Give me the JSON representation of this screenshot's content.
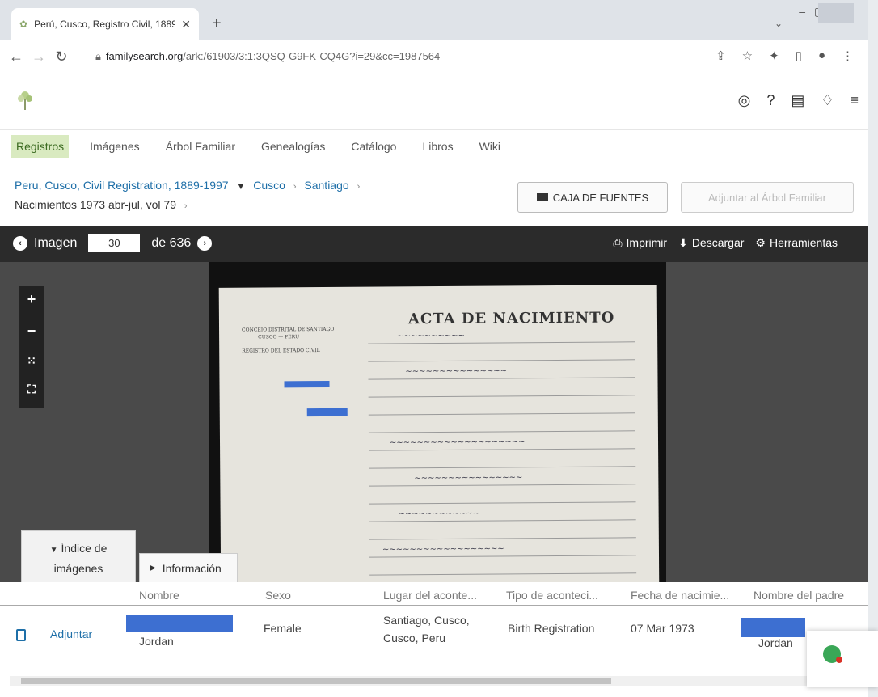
{
  "browser": {
    "tab_title": "Perú, Cusco, Registro Civil, 1889-",
    "url_host": "familysearch.org",
    "url_path": "/ark:/61903/3:1:3QSQ-G9FK-CQ4G?i=29&cc=1987564"
  },
  "nav": {
    "items": [
      "Registros",
      "Imágenes",
      "Árbol Familiar",
      "Genealogías",
      "Catálogo",
      "Libros",
      "Wiki"
    ],
    "active": "Registros"
  },
  "breadcrumb": {
    "collection": "Peru, Cusco, Civil Registration, 1889-1997",
    "level1": "Cusco",
    "level2": "Santiago",
    "volume": "Nacimientos 1973 abr-jul, vol 79"
  },
  "buttons": {
    "caja": "CAJA DE FUENTES",
    "adjuntar_arbol": "Adjuntar al Árbol Familiar"
  },
  "viewer": {
    "imagen_label": "Imagen",
    "page": "30",
    "of_label": "de 636",
    "print": "Imprimir",
    "download": "Descargar",
    "tools": "Herramientas",
    "doc_title": "ACTA DE NACIMIENTO",
    "doc_org": "CONCEJO DISTRITAL DE SANTIAGO",
    "doc_country": "CUSCO — PERU",
    "doc_office": "REGISTRO DEL ESTADO CIVIL"
  },
  "panels": {
    "indice_line1": "Índice de",
    "indice_line2": "imágenes",
    "informacion": "Información"
  },
  "table": {
    "headers": [
      "Nombre",
      "Sexo",
      "Lugar del aconte...",
      "Tipo de aconteci...",
      "Fecha de nacimie...",
      "Nombre del padre"
    ],
    "row": {
      "action": "Adjuntar",
      "name_visible": "Jordan",
      "sex": "Female",
      "place_line1": "Santiago, Cusco,",
      "place_line2": "Cusco, Peru",
      "event_type": "Birth Registration",
      "birth_date": "07 Mar 1973",
      "father_visible": "Jordan"
    }
  },
  "colors": {
    "link": "#1e6fa8",
    "active_nav": "#d9eac0",
    "toolbar": "#2b2b2b",
    "redaction": "#3d6fd1"
  }
}
